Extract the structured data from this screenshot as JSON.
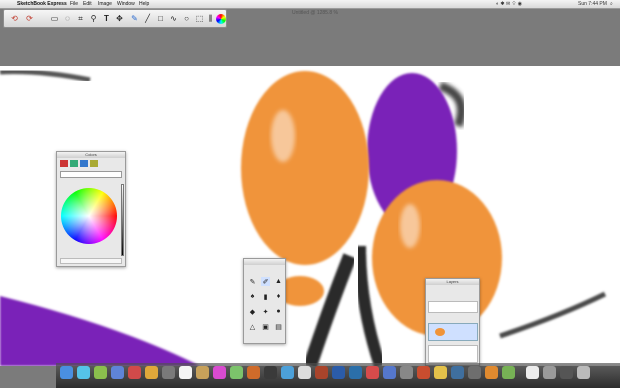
{
  "menubar": {
    "apple_glyph": "",
    "items": [
      "SketchBook Express",
      "File",
      "Edit",
      "Image",
      "Window",
      "Help"
    ],
    "clock": "Sun 7:44 PM"
  },
  "document": {
    "title": "Untitled @ 1285.8 %"
  },
  "colors": {
    "balloon_orange": "#f0943a",
    "balloon_purple": "#7a22b8",
    "string_dark": "#2a2a2a",
    "canvas_bg": "#ffffff",
    "desk_gray": "#7b7b7b"
  },
  "toolbar": {
    "tools": [
      "undo-icon",
      "redo-icon",
      "select-rect-icon",
      "lasso-icon",
      "crop-icon",
      "zoom-icon",
      "text-icon",
      "move-icon",
      "brush-icon",
      "line-icon",
      "rect-icon",
      "ellipse-icon",
      "shape-icon",
      "pan-icon",
      "symmetry-icon",
      "paint-icon",
      "color-wheel-icon"
    ]
  },
  "panels": {
    "color_editor": {
      "title": "Colors"
    },
    "brush_palette": {
      "title": ""
    },
    "layer_editor": {
      "title": "Layers"
    }
  }
}
